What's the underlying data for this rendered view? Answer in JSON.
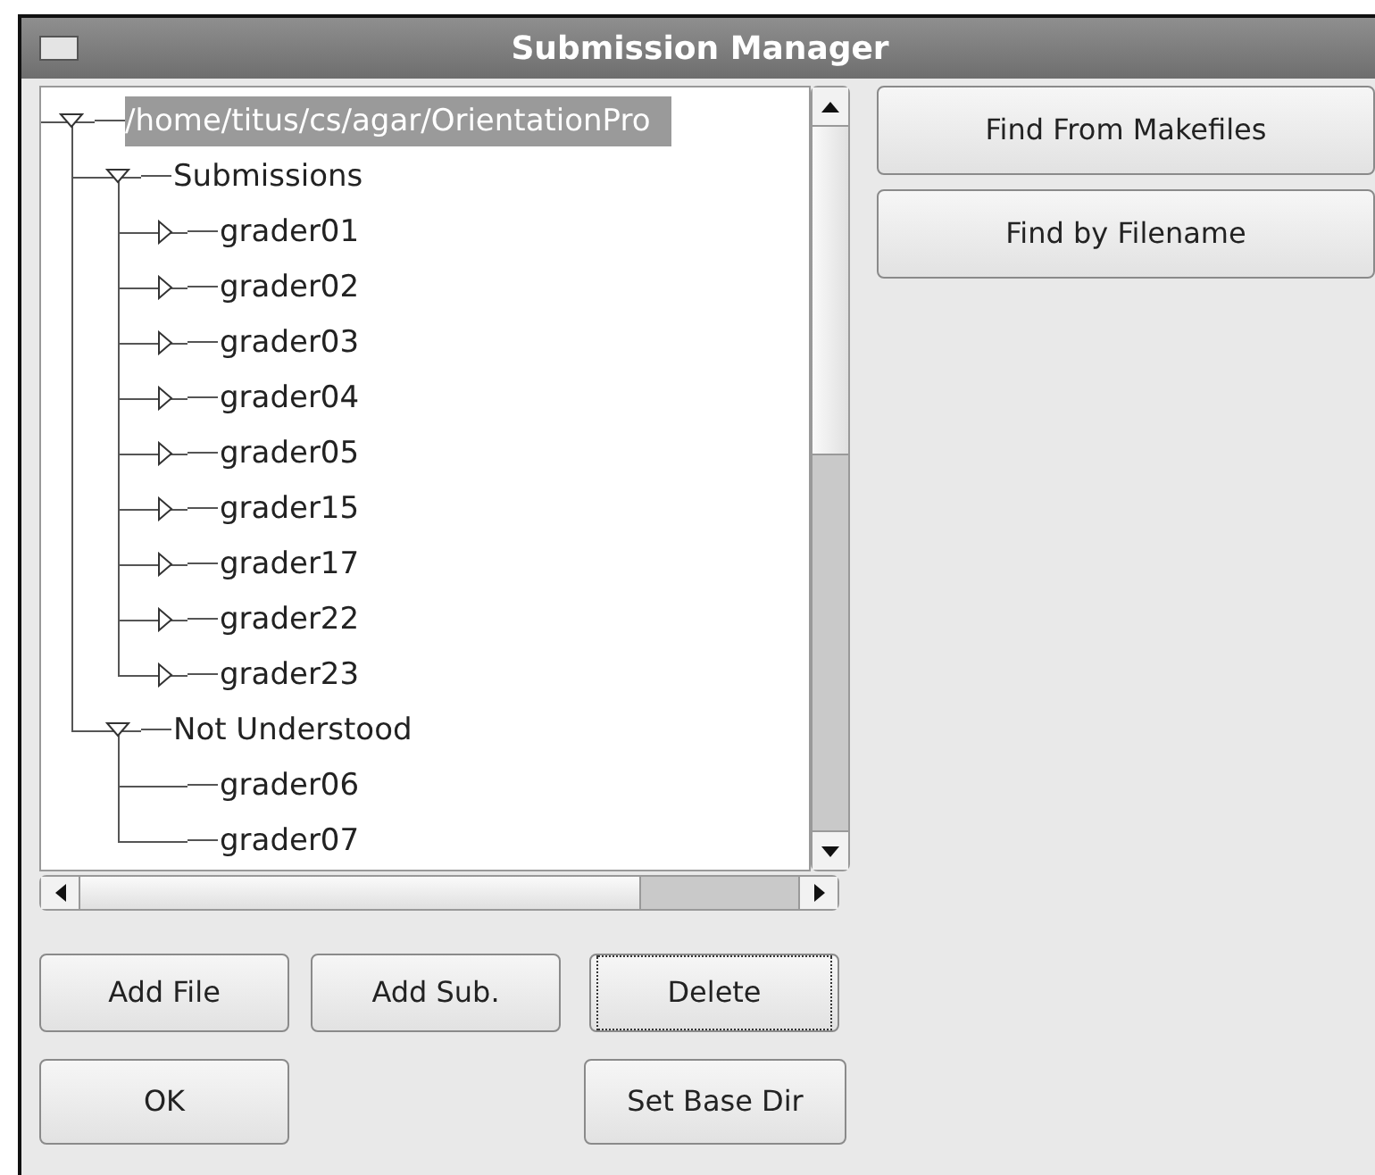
{
  "window": {
    "title": "Submission Manager"
  },
  "tree": [
    {
      "label": "/home/titus/cs/agar/OrientationPro",
      "kind": "folder",
      "expanded": true,
      "selected": true,
      "children": [
        {
          "label": "Submissions",
          "kind": "folder",
          "expanded": true,
          "selected": false,
          "children": [
            {
              "label": "grader01",
              "kind": "folder",
              "expanded": false,
              "selected": false
            },
            {
              "label": "grader02",
              "kind": "folder",
              "expanded": false,
              "selected": false
            },
            {
              "label": "grader03",
              "kind": "folder",
              "expanded": false,
              "selected": false
            },
            {
              "label": "grader04",
              "kind": "folder",
              "expanded": false,
              "selected": false
            },
            {
              "label": "grader05",
              "kind": "folder",
              "expanded": false,
              "selected": false
            },
            {
              "label": "grader15",
              "kind": "folder",
              "expanded": false,
              "selected": false
            },
            {
              "label": "grader17",
              "kind": "folder",
              "expanded": false,
              "selected": false
            },
            {
              "label": "grader22",
              "kind": "folder",
              "expanded": false,
              "selected": false
            },
            {
              "label": "grader23",
              "kind": "folder",
              "expanded": false,
              "selected": false
            }
          ]
        },
        {
          "label": "Not Understood",
          "kind": "folder",
          "expanded": true,
          "selected": false,
          "children": [
            {
              "label": "grader06",
              "kind": "file",
              "selected": false
            },
            {
              "label": "grader07",
              "kind": "file",
              "selected": false
            }
          ]
        }
      ]
    }
  ],
  "side_buttons": [
    {
      "label": "Find From Makefiles"
    },
    {
      "label": "Find by Filename"
    }
  ],
  "buttons": [
    {
      "label": "Add File",
      "focused": false
    },
    {
      "label": "Add Sub.",
      "focused": false
    },
    {
      "label": "Delete",
      "focused": true
    }
  ],
  "bottom_buttons": [
    {
      "label": "OK"
    },
    {
      "label": "Set Base Dir"
    }
  ]
}
